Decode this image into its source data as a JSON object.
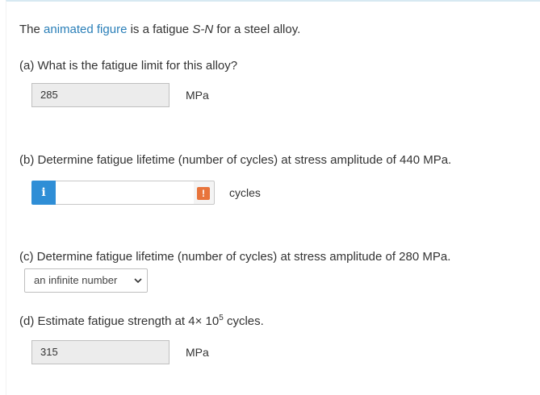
{
  "intro": {
    "prefix": "The ",
    "link_text": "animated figure",
    "middle": " is a fatigue ",
    "italic_term": "S-N",
    "suffix": " for a steel alloy."
  },
  "part_a": {
    "question": "(a) What is the fatigue limit for this alloy?",
    "answer": "285",
    "unit": "MPa"
  },
  "part_b": {
    "question": "(b) Determine fatigue lifetime (number of cycles) at stress amplitude of 440 MPa.",
    "info_icon_glyph": "i",
    "input_value": "",
    "warning_icon_glyph": "!",
    "unit": "cycles"
  },
  "part_c": {
    "question": "(c) Determine fatigue lifetime (number of cycles) at stress amplitude of 280 MPa.",
    "selected_option": "an infinite number"
  },
  "part_d": {
    "question_prefix": "(d) Estimate fatigue strength at 4× 10",
    "question_exponent": "5",
    "question_suffix": " cycles.",
    "answer": "315",
    "unit": "MPa"
  },
  "colors": {
    "link": "#2a7fb8",
    "info_button": "#2f8ed6",
    "warning_badge": "#e8743b"
  },
  "icons": {
    "info": "info-icon",
    "warning": "warning-icon",
    "chevron": "chevron-down-icon"
  }
}
